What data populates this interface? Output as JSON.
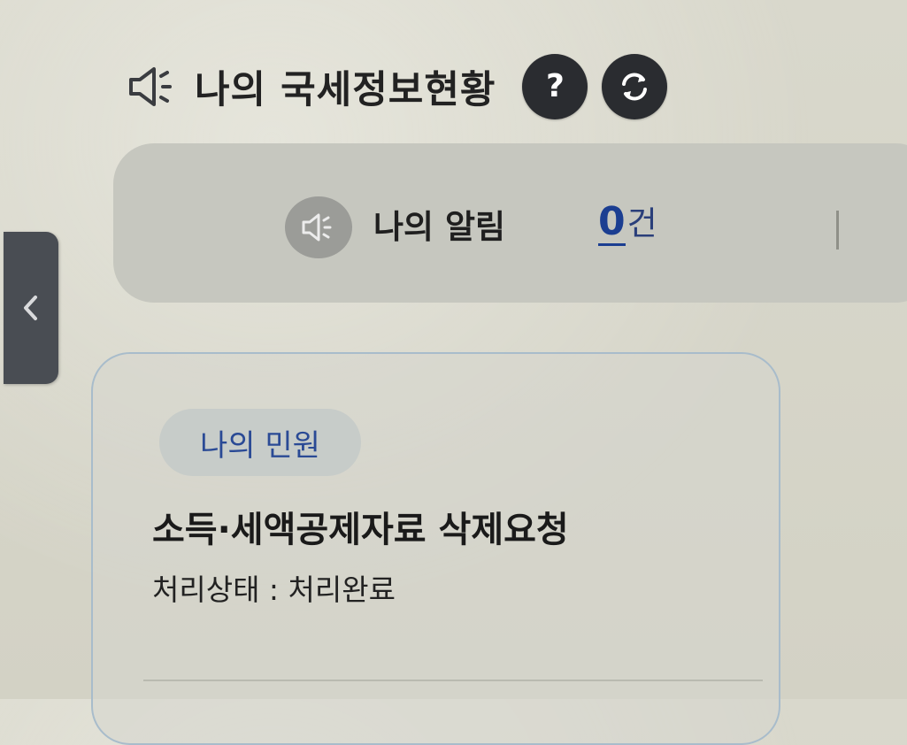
{
  "header": {
    "speaker_icon": "speaker-icon",
    "title": "나의 국세정보현황",
    "help_label": "?",
    "help_icon": "help-icon",
    "refresh_icon": "refresh-icon"
  },
  "side_tab": {
    "icon": "chevron-left-icon"
  },
  "notifications": {
    "icon": "speaker-icon",
    "label": "나의 알림",
    "count": "0",
    "unit": "건"
  },
  "complaint_card": {
    "chip": "나의 민원",
    "title": "소득·세액공제자료 삭제요청",
    "status": "처리상태 : 처리완료"
  },
  "colors": {
    "accent_blue": "#1b3e91",
    "dark_button": "#2a2c30",
    "side_tab": "#494d53"
  }
}
